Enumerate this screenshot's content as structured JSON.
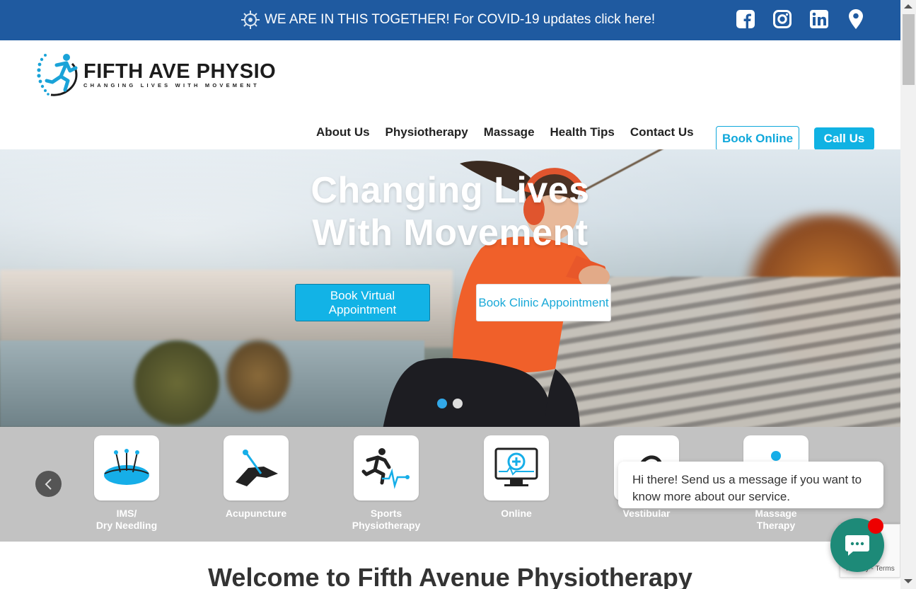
{
  "topbar": {
    "covid_text": "WE ARE IN THIS TOGETHER! For COVID-19 updates click here!",
    "background": "#1f5aa0",
    "social_icons": [
      "facebook-icon",
      "instagram-icon",
      "linkedin-icon",
      "location-pin-icon"
    ]
  },
  "brand": {
    "title": "FIFTH AVE PHYSIO",
    "tagline": "CHANGING LIVES WITH MOVEMENT",
    "accent": "#10a8db"
  },
  "nav": {
    "items": [
      "About Us",
      "Physiotherapy",
      "Massage",
      "Health Tips",
      "Contact Us"
    ],
    "book_online": "Book Online",
    "call_us": "Call Us"
  },
  "hero": {
    "title_line1": "Changing Lives",
    "title_line2": "With Movement",
    "btn_virtual": "Book Virtual Appointment",
    "btn_clinic": "Book Clinic Appointment",
    "slides": 2,
    "active_slide": 1
  },
  "services": {
    "items": [
      {
        "label_line1": "IMS/",
        "label_line2": "Dry Needling",
        "icon": "needles-icon"
      },
      {
        "label_line1": "Acupuncture",
        "label_line2": "",
        "icon": "acupuncture-hand-icon"
      },
      {
        "label_line1": "Sports",
        "label_line2": "Physiotherapy",
        "icon": "runner-heartbeat-icon"
      },
      {
        "label_line1": "Online",
        "label_line2": "",
        "icon": "monitor-medical-icon"
      },
      {
        "label_line1": "Vestibular",
        "label_line2": "",
        "icon": "ear-icon"
      },
      {
        "label_line1": "Massage",
        "label_line2": "Therapy",
        "icon": "massage-person-icon"
      }
    ]
  },
  "chat": {
    "message": "Hi there! Send us a message if you want to know more about our service."
  },
  "recaptcha": {
    "terms": "Privacy - Terms"
  },
  "welcome": {
    "heading": "Welcome to Fifth Avenue Physiotherapy"
  }
}
